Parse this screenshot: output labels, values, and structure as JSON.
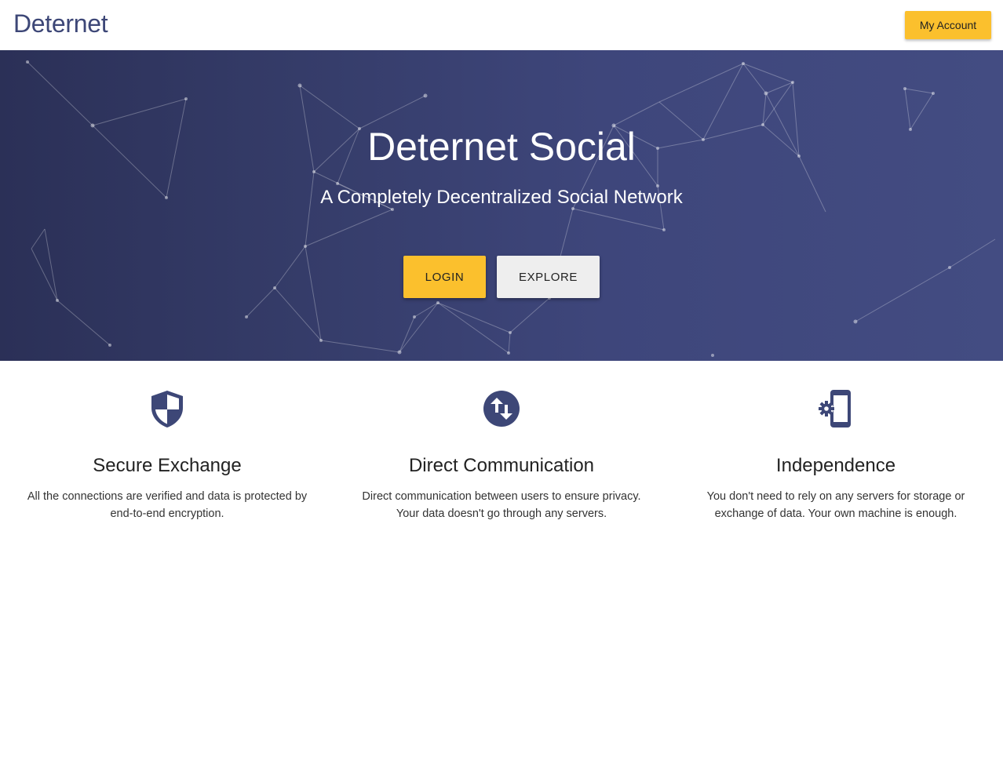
{
  "header": {
    "brand": "Deternet",
    "account_label": "My Account"
  },
  "hero": {
    "title": "Deternet Social",
    "subtitle": "A Completely Decentralized Social Network",
    "login_label": "LOGIN",
    "explore_label": "EXPLORE"
  },
  "features": [
    {
      "icon": "shield-icon",
      "title": "Secure Exchange",
      "description": "All the connections are verified and data is protected by end-to-end encryption."
    },
    {
      "icon": "swap-vertical-icon",
      "title": "Direct Communication",
      "description": "Direct communication between users to ensure privacy. Your data doesn't go through any servers."
    },
    {
      "icon": "phone-settings-icon",
      "title": "Independence",
      "description": "You don't need to rely on any servers for storage or exchange of data. Your own machine is enough."
    }
  ],
  "colors": {
    "accent": "#fbc02d",
    "brand": "#3d4777",
    "hero_dark": "#2b3057",
    "hero_light": "#434c82",
    "secondary_button": "#eeeeee"
  }
}
